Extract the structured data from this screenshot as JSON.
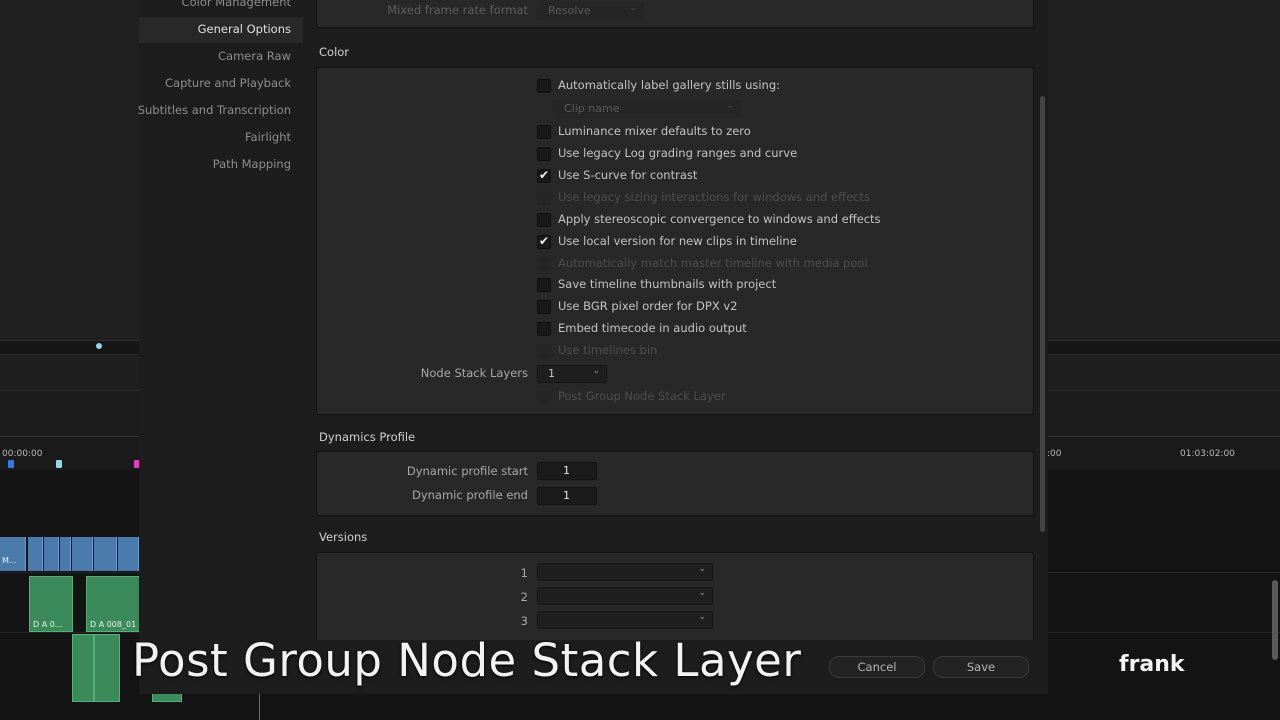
{
  "nav": {
    "items": [
      {
        "label": "Color Management",
        "selected": false
      },
      {
        "label": "General Options",
        "selected": true
      },
      {
        "label": "Camera Raw",
        "selected": false
      },
      {
        "label": "Capture and Playback",
        "selected": false
      },
      {
        "label": "Subtitles and Transcription",
        "selected": false
      },
      {
        "label": "Fairlight",
        "selected": false
      },
      {
        "label": "Path Mapping",
        "selected": false
      }
    ]
  },
  "top_row": {
    "label": "Mixed frame rate format",
    "value": "Resolve"
  },
  "color": {
    "title": "Color",
    "gallery_dropdown": "Clip name",
    "options": [
      {
        "label": "Automatically label gallery stills using:",
        "checked": false,
        "enabled": true
      },
      {
        "label": "Luminance mixer defaults to zero",
        "checked": false,
        "enabled": true
      },
      {
        "label": "Use legacy Log grading ranges and curve",
        "checked": false,
        "enabled": true
      },
      {
        "label": "Use S-curve for contrast",
        "checked": true,
        "enabled": true
      },
      {
        "label": "Use legacy sizing interactions for windows and effects",
        "checked": false,
        "enabled": false
      },
      {
        "label": "Apply stereoscopic convergence to windows and effects",
        "checked": false,
        "enabled": true
      },
      {
        "label": "Use local version for new clips in timeline",
        "checked": true,
        "enabled": true
      },
      {
        "label": "Automatically match master timeline with media pool",
        "checked": false,
        "enabled": false
      },
      {
        "label": "Save timeline thumbnails with project",
        "checked": false,
        "enabled": true
      },
      {
        "label": "Use BGR pixel order for DPX v2",
        "checked": false,
        "enabled": true
      },
      {
        "label": "Embed timecode in audio output",
        "checked": false,
        "enabled": true
      },
      {
        "label": "Use timelines bin",
        "checked": false,
        "enabled": false
      }
    ],
    "node_stack_label": "Node Stack Layers",
    "node_stack_value": "1",
    "post_group_label": "Post Group Node Stack Layer"
  },
  "dynamics": {
    "title": "Dynamics Profile",
    "start_label": "Dynamic profile start",
    "start_value": "1",
    "end_label": "Dynamic profile end",
    "end_value": "1"
  },
  "versions": {
    "title": "Versions",
    "rows": [
      "1",
      "2",
      "3"
    ]
  },
  "buttons": {
    "cancel": "Cancel",
    "save": "Save"
  },
  "timeline": {
    "tc_left": "00:00:00",
    "tc_mid": ":00",
    "tc_right": "01:03:02:00",
    "video_clip_label": "M...",
    "audio_clip_1": "D A 0...",
    "audio_clip_2": "D A 008_01"
  },
  "caption": "Post Group Node Stack Layer",
  "brand": "frank",
  "colors": {
    "accent_blue": "#4a7bab",
    "audio_green": "#3a8a5a",
    "playhead": "#d84040"
  }
}
